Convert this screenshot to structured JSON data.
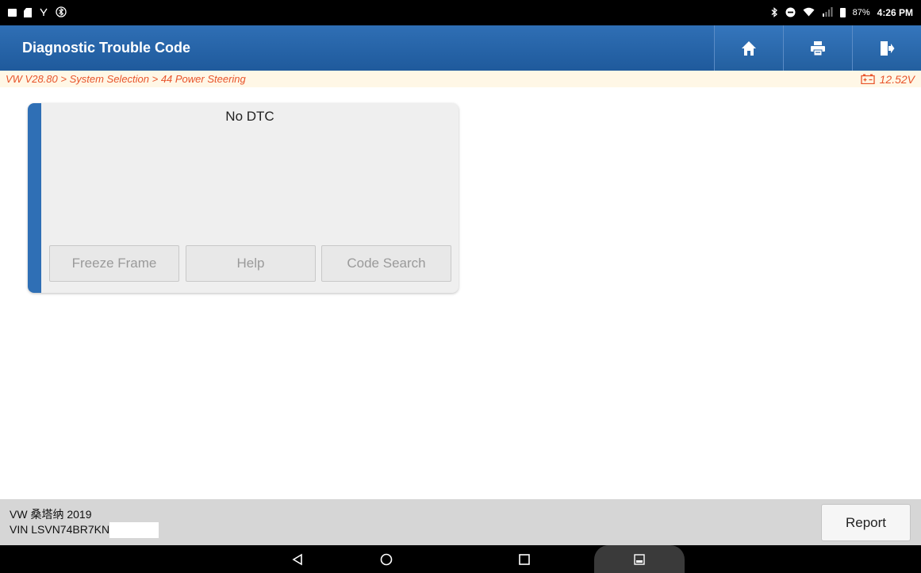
{
  "status_bar": {
    "battery_percent": "87%",
    "time": "4:26 PM",
    "left_icons": [
      "image-icon",
      "sd-card-icon",
      "usb-debug-icon",
      "bluetooth-off-icon"
    ],
    "right_icons": [
      "bluetooth-icon",
      "do-not-disturb-icon",
      "wifi-icon",
      "signal-icon",
      "battery-icon"
    ]
  },
  "header": {
    "title": "Diagnostic Trouble Code",
    "buttons": [
      "home-icon",
      "print-icon",
      "exit-icon"
    ],
    "color": "#2f6fb5"
  },
  "breadcrumb": {
    "path": "VW V28.80 > System Selection > 44 Power Steering",
    "voltage": "12.52V",
    "color": "#e8542b"
  },
  "dtc_card": {
    "title": "No DTC",
    "buttons": {
      "freeze_frame": "Freeze Frame",
      "help": "Help",
      "code_search": "Code Search"
    }
  },
  "footer": {
    "vehicle": "VW 桑塔纳 2019",
    "vin": "VIN LSVN74BR7KN",
    "report_label": "Report"
  },
  "nav_bar": {
    "icons": [
      "back-icon",
      "home-circle-icon",
      "recents-icon",
      "screenshot-icon"
    ]
  }
}
